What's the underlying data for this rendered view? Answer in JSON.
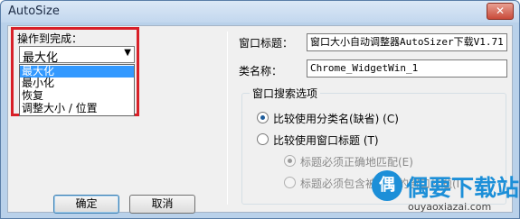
{
  "window": {
    "title": "AutoSize",
    "close_glyph": "✕"
  },
  "left": {
    "label": "操作到完成：",
    "combo_value": "最大化",
    "combo_arrow": "▼",
    "options": [
      "最大化",
      "最小化",
      "恢复",
      "调整大小 / 位置"
    ],
    "selected_index": 0
  },
  "fields": {
    "window_title_label": "窗口标题：",
    "window_title_value": "窗口大小自动调整器AutoSizer下载V1.71",
    "class_label": "类名称：",
    "class_value": "Chrome_WidgetWin_1"
  },
  "search": {
    "group_title": "窗口搜索选项",
    "opt_class": "比较使用分类名(缺省) (C)",
    "opt_title": "比较使用窗口标题  (T)",
    "sub_exact": "标题必须正确地匹配(E)",
    "sub_partial": "标题必须包含被列出的窗口标题(I)"
  },
  "buttons": {
    "ok": "确定",
    "cancel": "取消"
  },
  "watermark": {
    "logo_text": "偶",
    "brand": "偶要下载站",
    "url": "ouyaoxiazai.com"
  },
  "colors": {
    "highlight": "#3399ff",
    "red_frame": "#d82028",
    "brand": "#1c8fd8"
  }
}
